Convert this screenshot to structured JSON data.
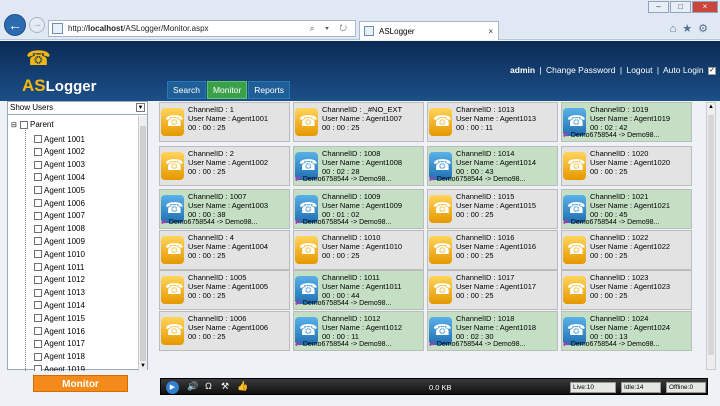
{
  "browser": {
    "url_prefix": "http://",
    "url_host": "localhost",
    "url_path": "/ASLogger/Monitor.aspx",
    "tab_title": "ASLogger",
    "addr_icons": "⌕ ▾ ↻",
    "back_glyph": "←",
    "fwd_glyph": "→",
    "tab_close": "×",
    "win_min": "–",
    "win_max": "□",
    "win_close": "×",
    "tools": "⌂★⚙"
  },
  "header": {
    "logo_prefix": "AS",
    "logo_rest": "Logger",
    "user": "admin",
    "change_password": "Change Password",
    "logout": "Logout",
    "auto_login": "Auto Login",
    "separator": "|",
    "auto_login_checked": "✓"
  },
  "nav": {
    "search": "Search",
    "monitor": "Monitor",
    "reports": "Reports"
  },
  "sidebar": {
    "show_users": "Show Users",
    "parent_label": "Parent",
    "agents": [
      "Agent 1001",
      "Agent 1002",
      "Agent 1003",
      "Agent 1004",
      "Agent 1005",
      "Agent 1006",
      "Agent 1007",
      "Agent 1008",
      "Agent 1009",
      "Agent 1010",
      "Agent 1011",
      "Agent 1012",
      "Agent 1013",
      "Agent 1014",
      "Agent 1015",
      "Agent 1016",
      "Agent 1017",
      "Agent 1018",
      "Agent 1019"
    ],
    "monitor_button": "Monitor"
  },
  "channels": [
    {
      "id": "ChannelID : 1",
      "user": "User Name : Agent1001",
      "time": "00 : 00 : 25",
      "active": false,
      "demo": ""
    },
    {
      "id": "ChannelID : _#NO_EXT",
      "user": "User Name : Agent1007",
      "time": "00 : 00 : 25",
      "active": false,
      "demo": ""
    },
    {
      "id": "ChannelID : 1013",
      "user": "User Name : Agent1013",
      "time": "00 : 00 : 11",
      "active": false,
      "demo": ""
    },
    {
      "id": "ChannelID : 1019",
      "user": "User Name : Agent1019",
      "time": "00 : 02 : 42",
      "active": true,
      "demo": "Demo6758544 -> Demo98..."
    },
    {
      "id": "ChannelID : 2",
      "user": "User Name : Agent1002",
      "time": "00 : 00 : 25",
      "active": false,
      "demo": ""
    },
    {
      "id": "ChannelID : 1008",
      "user": "User Name : Agent1008",
      "time": "00 : 02 : 28",
      "active": true,
      "demo": "Demo6758544 -> Demo98..."
    },
    {
      "id": "ChannelID : 1014",
      "user": "User Name : Agent1014",
      "time": "00 : 00 : 43",
      "active": true,
      "demo": "Demo6758544 -> Demo98..."
    },
    {
      "id": "ChannelID : 1020",
      "user": "User Name : Agent1020",
      "time": "00 : 00 : 25",
      "active": false,
      "demo": ""
    },
    {
      "id": "ChannelID : 1007",
      "user": "User Name : Agent1003",
      "time": "00 : 00 : 38",
      "active": true,
      "demo": "Demo6758544 -> Demo98..."
    },
    {
      "id": "ChannelID : 1009",
      "user": "User Name : Agent1009",
      "time": "00 : 01 : 02",
      "active": true,
      "demo": "Demo6758544 -> Demo98..."
    },
    {
      "id": "ChannelID : 1015",
      "user": "User Name : Agent1015",
      "time": "00 : 00 : 25",
      "active": false,
      "demo": ""
    },
    {
      "id": "ChannelID : 1021",
      "user": "User Name : Agent1021",
      "time": "00 : 00 : 45",
      "active": true,
      "demo": "Demo6758544 -> Demo98..."
    },
    {
      "id": "ChannelID : 4",
      "user": "User Name : Agent1004",
      "time": "00 : 00 : 25",
      "active": false,
      "demo": ""
    },
    {
      "id": "ChannelID : 1010",
      "user": "User Name : Agent1010",
      "time": "00 : 00 : 25",
      "active": false,
      "demo": ""
    },
    {
      "id": "ChannelID : 1016",
      "user": "User Name : Agent1016",
      "time": "00 : 00 : 25",
      "active": false,
      "demo": ""
    },
    {
      "id": "ChannelID : 1022",
      "user": "User Name : Agent1022",
      "time": "00 : 00 : 25",
      "active": false,
      "demo": ""
    },
    {
      "id": "ChannelID : 1005",
      "user": "User Name : Agent1005",
      "time": "00 : 00 : 25",
      "active": false,
      "demo": ""
    },
    {
      "id": "ChannelID : 1011",
      "user": "User Name : Agent1011",
      "time": "00 : 00 : 44",
      "active": true,
      "demo": "Demo6758544 -> Demo98..."
    },
    {
      "id": "ChannelID : 1017",
      "user": "User Name : Agent1017",
      "time": "00 : 00 : 25",
      "active": false,
      "demo": ""
    },
    {
      "id": "ChannelID : 1023",
      "user": "User Name : Agent1023",
      "time": "00 : 00 : 25",
      "active": false,
      "demo": ""
    },
    {
      "id": "ChannelID : 1006",
      "user": "User Name : Agent1006",
      "time": "00 : 00 : 25",
      "active": false,
      "demo": ""
    },
    {
      "id": "ChannelID : 1012",
      "user": "User Name : Agent1012",
      "time": "00 : 00 : 11",
      "active": true,
      "demo": "Demo6758544 -> Demo98..."
    },
    {
      "id": "ChannelID : 1018",
      "user": "User Name : Agent1018",
      "time": "00 : 02 : 30",
      "active": true,
      "demo": "Demo6758544 -> Demo98..."
    },
    {
      "id": "ChannelID : 1024",
      "user": "User Name : Agent1024",
      "time": "00 : 00 : 13",
      "active": true,
      "demo": "Demo6758544 -> Demo98..."
    }
  ],
  "player": {
    "size": "0.0 KB",
    "live": "Live:10",
    "idle": "Idle:14",
    "offline": "Offline:0",
    "play_glyph": "▶",
    "volume_glyph": "🔊",
    "headset_glyph": "Ω",
    "tool_glyph": "⚒",
    "like_glyph": "👍"
  },
  "colors": {
    "active_tile": "#c4dfc4",
    "idle_tile": "#e3e3e3",
    "nav_active": "#3aa04a",
    "monitor_button": "#f48a1a",
    "header": "#0a2b55"
  }
}
